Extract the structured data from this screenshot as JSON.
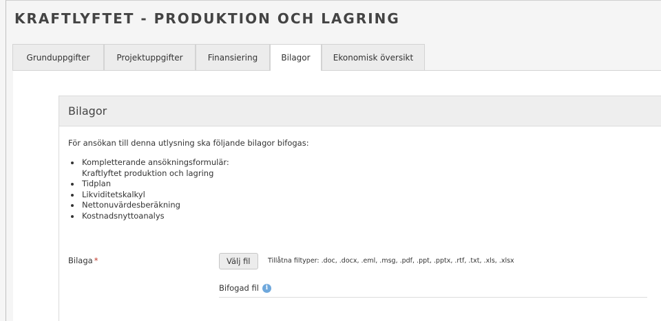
{
  "header": {
    "title": "KRAFTLYFTET - PRODUKTION OCH LAGRING"
  },
  "tabs": [
    {
      "label": "Grunduppgifter"
    },
    {
      "label": "Projektuppgifter"
    },
    {
      "label": "Finansiering"
    },
    {
      "label": "Bilagor",
      "active": true
    },
    {
      "label": "Ekonomisk översikt"
    }
  ],
  "section": {
    "heading": "Bilagor",
    "intro": "För ansökan till denna utlysning ska följande bilagor bifogas:",
    "attachments": [
      "Kompletterande ansökningsformulär:",
      "Kraftlyftet produktion och lagring",
      "Tidplan",
      "Likviditetskalkyl",
      "Nettonuvärdesberäkning",
      "Kostnadsnyttoanalys"
    ]
  },
  "upload": {
    "label": "Bilaga",
    "required_mark": "*",
    "button_label": "Välj fil",
    "allowed_types": "Tillåtna filtyper: .doc, .docx, .eml, .msg, .pdf, .ppt, .pptx, .rtf, .txt, .xls, .xlsx",
    "attached_label": "Bifogad fil",
    "info_icon": "info-circle-icon"
  }
}
